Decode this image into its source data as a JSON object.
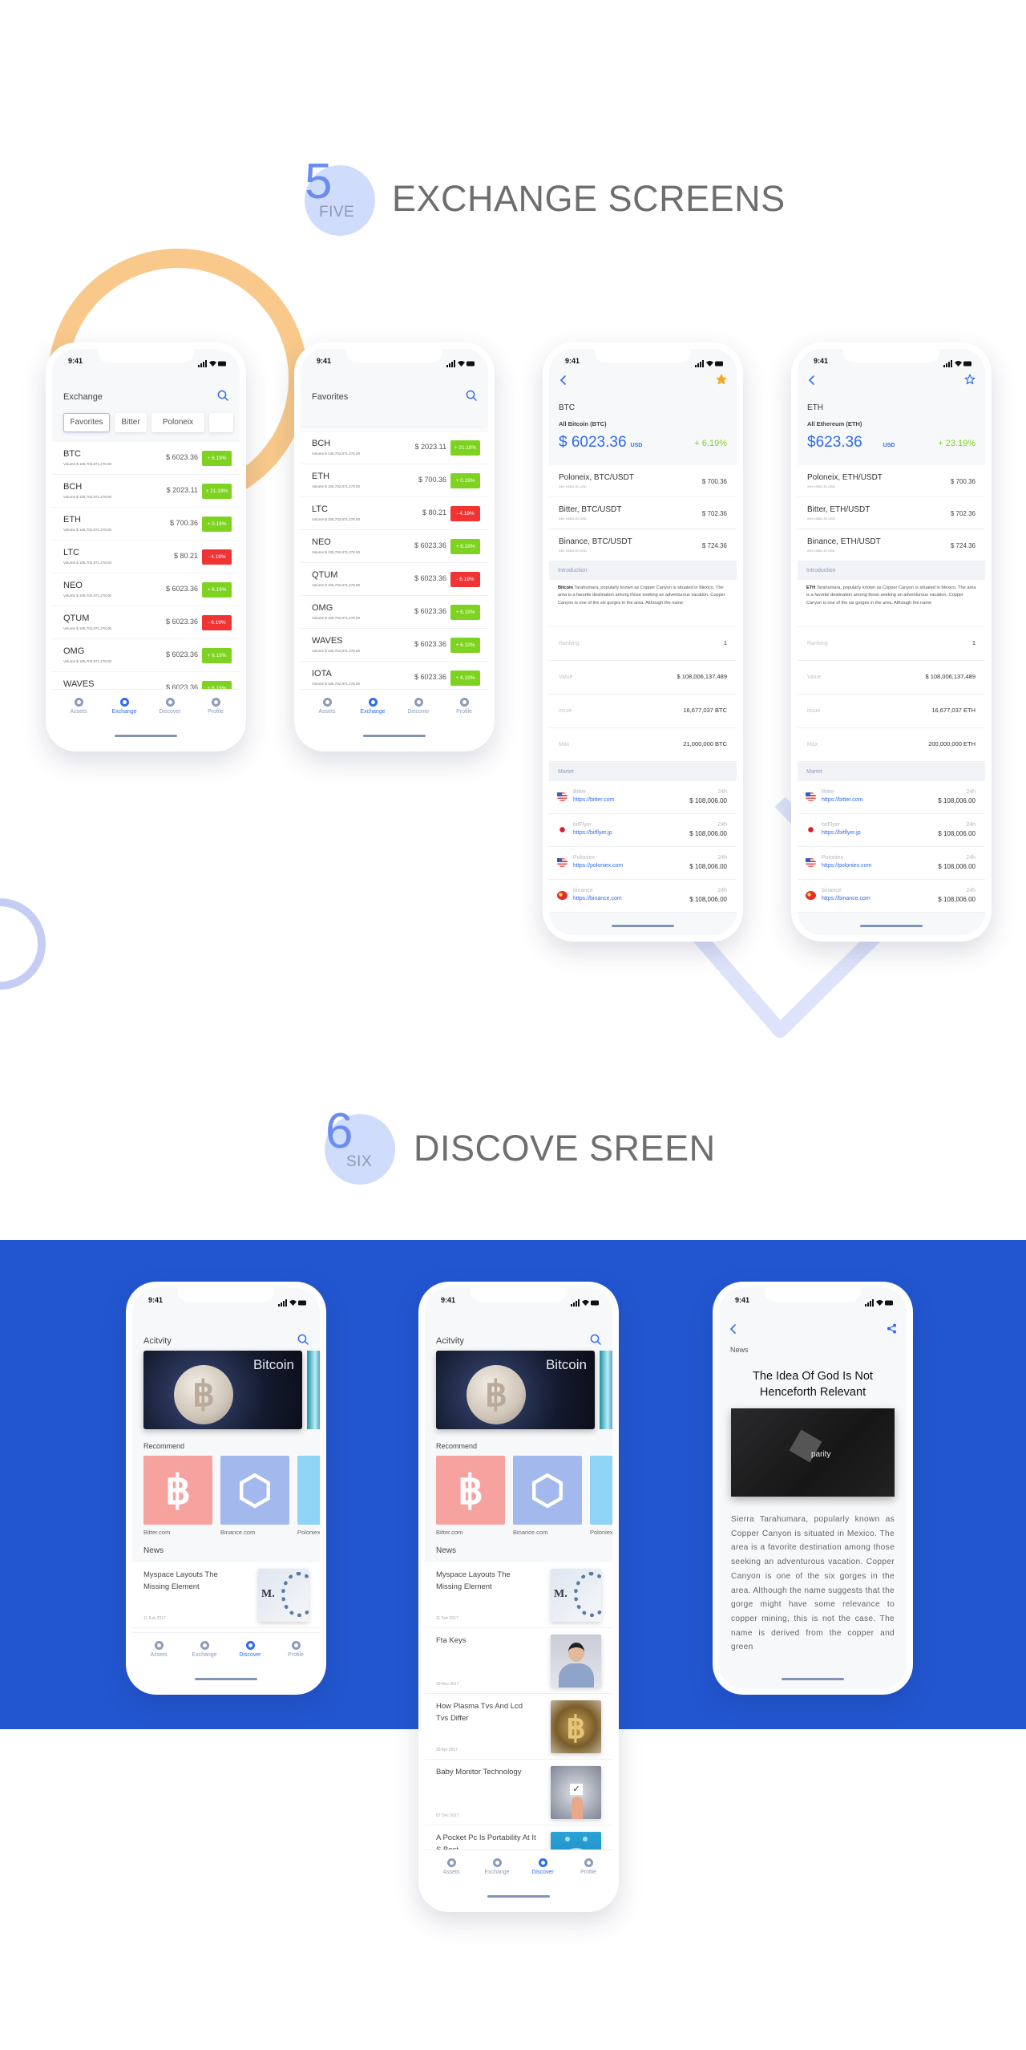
{
  "sections": [
    {
      "number": "5",
      "word": "FIVE",
      "title": "EXCHANGE SCREENS"
    },
    {
      "number": "6",
      "word": "SIX",
      "title": "DISCOVE SREEN"
    }
  ],
  "colors": {
    "accent": "#2f6bf0",
    "up": "#7ed321",
    "down": "#f03434",
    "band": "#2256d0",
    "star": "#f5a623",
    "decor_ring": "#f8c98a"
  },
  "status_time": "9:41",
  "tabbar": [
    "Assets",
    "Exchange",
    "Discover",
    "Profile"
  ],
  "exchange": {
    "title": "Exchange",
    "tabs": [
      "Favorites",
      "Bitter",
      "Poloneix"
    ],
    "rows": [
      {
        "symbol": "BTC",
        "volume": "Volume $ 105,702,871,278.00",
        "price": "$ 6023.36",
        "change": "+ 6.19%",
        "direction": "up"
      },
      {
        "symbol": "BCH",
        "volume": "Volume $ 105,702,871,278.00",
        "price": "$ 2023.11",
        "change": "+ 21.19%",
        "direction": "up"
      },
      {
        "symbol": "ETH",
        "volume": "Volume $ 105,702,871,278.00",
        "price": "$ 700.36",
        "change": "+ 0.19%",
        "direction": "up"
      },
      {
        "symbol": "LTC",
        "volume": "Volume $ 105,702,871,278.00",
        "price": "$ 80.21",
        "change": "- 4.19%",
        "direction": "down"
      },
      {
        "symbol": "NEO",
        "volume": "Volume $ 105,702,871,278.00",
        "price": "$ 6023.36",
        "change": "+ 6.19%",
        "direction": "up"
      },
      {
        "symbol": "QTUM",
        "volume": "Volume $ 105,702,871,278.00",
        "price": "$ 6023.36",
        "change": "- 6.19%",
        "direction": "down"
      },
      {
        "symbol": "OMG",
        "volume": "Volume $ 105,702,871,278.00",
        "price": "$ 6023.36",
        "change": "+ 6.19%",
        "direction": "up"
      },
      {
        "symbol": "WAVES",
        "volume": "Volume $ 105,702,871,278.00",
        "price": "$ 6023.36",
        "change": "+ 6.19%",
        "direction": "up"
      }
    ]
  },
  "favorites": {
    "title": "Favorites",
    "rows": [
      {
        "symbol": "BTC",
        "volume": "Volume $ 105,702,871,278.00",
        "price": "$ 6023.36",
        "change": "+ 6.19%",
        "direction": "up"
      },
      {
        "symbol": "BCH",
        "volume": "Volume $ 105,702,871,278.00",
        "price": "$ 2023.11",
        "change": "+ 21.19%",
        "direction": "up"
      },
      {
        "symbol": "ETH",
        "volume": "Volume $ 105,702,871,278.00",
        "price": "$ 700.36",
        "change": "+ 0.19%",
        "direction": "up"
      },
      {
        "symbol": "LTC",
        "volume": "Volume $ 105,702,871,278.00",
        "price": "$ 80.21",
        "change": "- 4.19%",
        "direction": "down"
      },
      {
        "symbol": "NEO",
        "volume": "Volume $ 105,702,871,278.00",
        "price": "$ 6023.36",
        "change": "+ 6.19%",
        "direction": "up"
      },
      {
        "symbol": "QTUM",
        "volume": "Volume $ 105,702,871,278.00",
        "price": "$ 6023.36",
        "change": "- 6.19%",
        "direction": "down"
      },
      {
        "symbol": "OMG",
        "volume": "Volume $ 105,702,871,278.00",
        "price": "$ 6023.36",
        "change": "+ 6.19%",
        "direction": "up"
      },
      {
        "symbol": "WAVES",
        "volume": "Volume $ 105,702,871,278.00",
        "price": "$ 6023.36",
        "change": "+ 6.19%",
        "direction": "up"
      },
      {
        "symbol": "IOTA",
        "volume": "Volume $ 105,702,871,278.00",
        "price": "$ 6023.36",
        "change": "+ 6.19%",
        "direction": "up"
      }
    ]
  },
  "details": [
    {
      "symbol": "BTC",
      "full_name": "All Bitcoin (BTC)",
      "price": "$ 6023.36",
      "unit": "USD",
      "change": "+ 6.19%",
      "favorited": true,
      "pairs": [
        {
          "name": "Poloneix, BTC/USDT",
          "sub": "24H 19301.91 USD",
          "price": "$ 700.36"
        },
        {
          "name": "Bitter, BTC/USDT",
          "sub": "24H 19301.91 USD",
          "price": "$ 702.36"
        },
        {
          "name": "Binance, BTC/USDT",
          "sub": "24H 19301.91 USD",
          "price": "$ 724.36"
        }
      ],
      "intro_label": "Introduction",
      "intro_bold": "Bitcoin",
      "intro_text": " Tarahumara, popularly known as Copper Canyon is situated in Mexico. The area is a favorite destination among those seeking an adventurous vacation. Copper Canyon is one of the six gorges in the area. Although the name",
      "stats": [
        {
          "label": "Ranking",
          "value": "1"
        },
        {
          "label": "Value",
          "value": "$ 108,006,137,489"
        },
        {
          "label": "issue",
          "value": "16,677,037 BTC"
        },
        {
          "label": "Max",
          "value": "21,000,000 BTC"
        }
      ],
      "market_label": "Martet",
      "markets": [
        {
          "name": "Bitter",
          "url": "https://bitter.com",
          "period": "24h",
          "value": "$ 108,006.00",
          "flag": "us"
        },
        {
          "name": "bitFlyer",
          "url": "https://bitflyer.jp",
          "period": "24h",
          "value": "$ 108,006.00",
          "flag": "jp"
        },
        {
          "name": "Poloniex",
          "url": "https://poloniex.com",
          "period": "24h",
          "value": "$ 108,006.00",
          "flag": "us"
        },
        {
          "name": "binance",
          "url": "https://binance.com",
          "period": "24h",
          "value": "$ 108,006.00",
          "flag": "cn"
        }
      ]
    },
    {
      "symbol": "ETH",
      "full_name": "All Ethereum (ETH)",
      "price": "$623.36",
      "unit": "USD",
      "change": "+ 23.19%",
      "favorited": false,
      "pairs": [
        {
          "name": "Poloneix, ETH/USDT",
          "sub": "24H 19301.91 USD",
          "price": "$ 700.36"
        },
        {
          "name": "Bitter, ETH/USDT",
          "sub": "24H 19301.91 USD",
          "price": "$ 702.36"
        },
        {
          "name": "Binance, ETH/USDT",
          "sub": "24H 19301.91 USD",
          "price": "$ 724.36"
        }
      ],
      "intro_label": "Introduction",
      "intro_bold": "ETH",
      "intro_text": " Tarahumara, popularly known as Copper Canyon is situated in Mexico. The area is a favorite destination among those seeking an adventurous vacation. Copper Canyon is one of the six gorges in the area. Although the name",
      "stats": [
        {
          "label": "Ranking",
          "value": "1"
        },
        {
          "label": "Value",
          "value": "$ 108,006,137,489"
        },
        {
          "label": "issue",
          "value": "16,677,037 ETH"
        },
        {
          "label": "Max",
          "value": "200,000,000 ETH"
        }
      ],
      "market_label": "Martet",
      "markets": [
        {
          "name": "Bitter",
          "url": "https://bitter.com",
          "period": "24h",
          "value": "$ 108,006.00",
          "flag": "us"
        },
        {
          "name": "bitFlyer",
          "url": "https://bitflyer.jp",
          "period": "24h",
          "value": "$ 108,006.00",
          "flag": "jp"
        },
        {
          "name": "Poloniex",
          "url": "https://poloniex.com",
          "period": "24h",
          "value": "$ 108,006.00",
          "flag": "us"
        },
        {
          "name": "binance",
          "url": "https://binance.com",
          "period": "24h",
          "value": "$ 108,006.00",
          "flag": "cn"
        }
      ]
    }
  ],
  "discover": {
    "title": "Acitvity",
    "banner_text": "Bitcoin",
    "recommend_label": "Recommend",
    "recommend": [
      {
        "label": "Bitter.com",
        "icon": "bitcoin-icon",
        "color": "#f6a3a0"
      },
      {
        "label": "Binance.com",
        "icon": "network-globe-icon",
        "color": "#a3b9ee"
      },
      {
        "label": "Poloniex.com",
        "icon": "poloniex-icon",
        "color": "#8fd3f5"
      }
    ],
    "news_label": "News",
    "news": [
      {
        "title": "Myspace Layouts The Missing Element",
        "date": "11 Feb 2017",
        "thumb": "myspace"
      },
      {
        "title": "Fta Keys",
        "date": "30 Nov 2017",
        "thumb": "person"
      },
      {
        "title": "How Plasma Tvs And Lcd Tvs Differ",
        "date": "30 Apr 2017",
        "thumb": "coin"
      },
      {
        "title": "Baby Monitor Technology",
        "date": "07 Dec 2017",
        "thumb": "check"
      },
      {
        "title": "A Pocket Pc Is Portability At It S Best",
        "thumb": "robot"
      }
    ]
  },
  "article": {
    "label": "News",
    "title": "The Idea Of God Is Not Henceforth Relevant",
    "image_text": "parity",
    "body": "Sierra Tarahumara, popularly known as Copper Canyon is situated in Mexico. The area is a favorite destination among those seeking an adventurous vacation. Copper Canyon is one of the six gorges in the area. Although the name suggests that the gorge might have some relevance to copper mining, this is not the case. The name is derived from the copper and green"
  }
}
